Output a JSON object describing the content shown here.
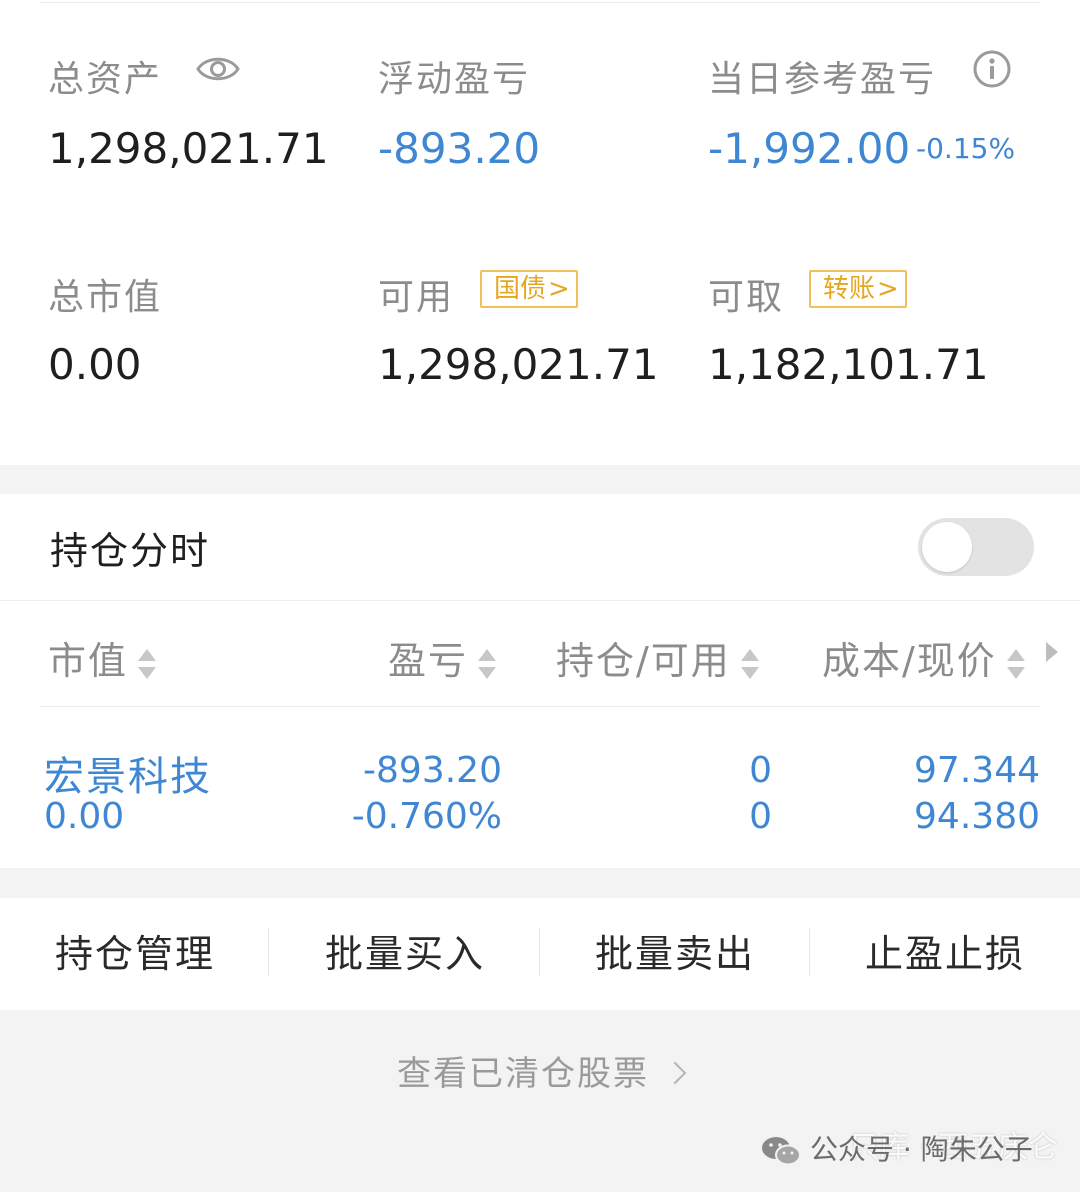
{
  "summary": {
    "total_assets_label": "总资产",
    "total_assets_value": "1,298,021.71",
    "floating_pl_label": "浮动盈亏",
    "floating_pl_value": "-893.20",
    "daily_ref_pl_label": "当日参考盈亏",
    "daily_ref_pl_value": "-1,992.00",
    "daily_ref_pl_pct": "-0.15%",
    "market_value_label": "总市值",
    "market_value_value": "0.00",
    "available_label": "可用",
    "available_tag": "国债",
    "available_value": "1,298,021.71",
    "withdrawable_label": "可取",
    "withdrawable_tag": "转账",
    "withdrawable_value": "1,182,101.71"
  },
  "holdings": {
    "title": "持仓分时",
    "toggle_on": false,
    "columns": [
      "市值",
      "盈亏",
      "持仓/可用",
      "成本/现价"
    ],
    "rows": [
      {
        "name": "宏景科技",
        "market_value": "0.00",
        "pl": "-893.20",
        "pl_pct": "-0.760%",
        "position": "0",
        "available": "0",
        "cost": "97.344",
        "price": "94.380"
      }
    ]
  },
  "actions": [
    "持仓管理",
    "批量买入",
    "批量卖出",
    "止盈止损"
  ],
  "footer": {
    "cleared_link": "查看已清仓股票",
    "watermark_front": "公众号 · 陶朱公子",
    "watermark_back": "只库 · 西五庆仑"
  },
  "colors": {
    "loss_blue": "#3f86d3",
    "tag_gold": "#e5a71f",
    "label_gray": "#8c8c8c"
  }
}
